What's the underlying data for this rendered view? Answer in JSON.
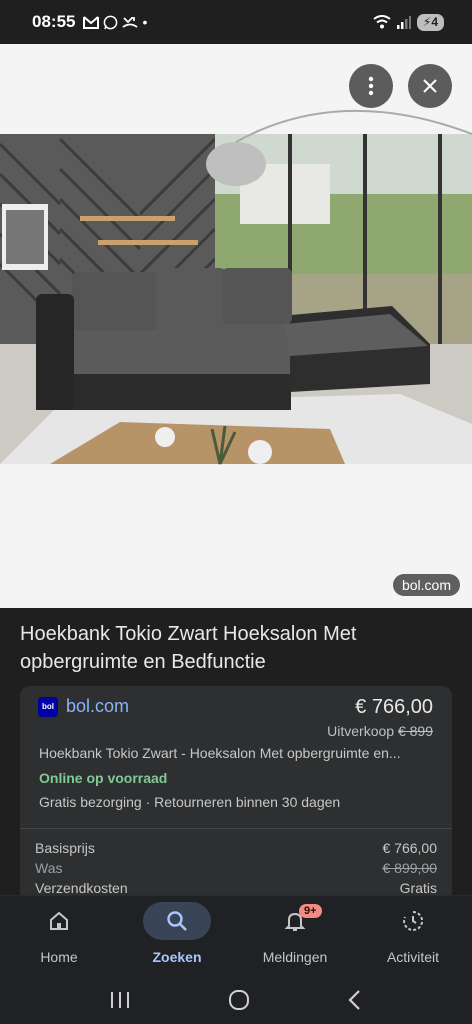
{
  "status_bar": {
    "time": "08:55",
    "battery": "4"
  },
  "image_viewer": {
    "source_label": "bol.com"
  },
  "product": {
    "title": "Hoekbank Tokio Zwart Hoeksalon Met opbergruimte en Bedfunctie"
  },
  "offer": {
    "merchant": "bol.com",
    "logo_text": "bol",
    "price": "€ 766,00",
    "sale_label": "Uitverkoop",
    "was_price": "€ 899",
    "description": "Hoekbank Tokio Zwart - Hoeksalon Met opbergruimte en...",
    "stock": "Online op voorraad",
    "shipping": "Gratis bezorging · Retourneren binnen 30 dagen",
    "rows": [
      {
        "label": "Basisprijs",
        "value": "€ 766,00"
      },
      {
        "label": "Was",
        "value": "€ 899,00"
      },
      {
        "label": "Verzendkosten",
        "value": "Gratis"
      }
    ]
  },
  "bottom_nav": {
    "items": [
      {
        "label": "Home",
        "icon": "home-icon"
      },
      {
        "label": "Zoeken",
        "icon": "search-icon",
        "active": true
      },
      {
        "label": "Meldingen",
        "icon": "bell-icon",
        "badge": "9+"
      },
      {
        "label": "Activiteit",
        "icon": "history-icon"
      }
    ]
  },
  "colors": {
    "background": "#1f1f1f",
    "accent": "#8ab4f8",
    "stock_green": "#81c995",
    "active_nav": "#a8c7fa"
  }
}
